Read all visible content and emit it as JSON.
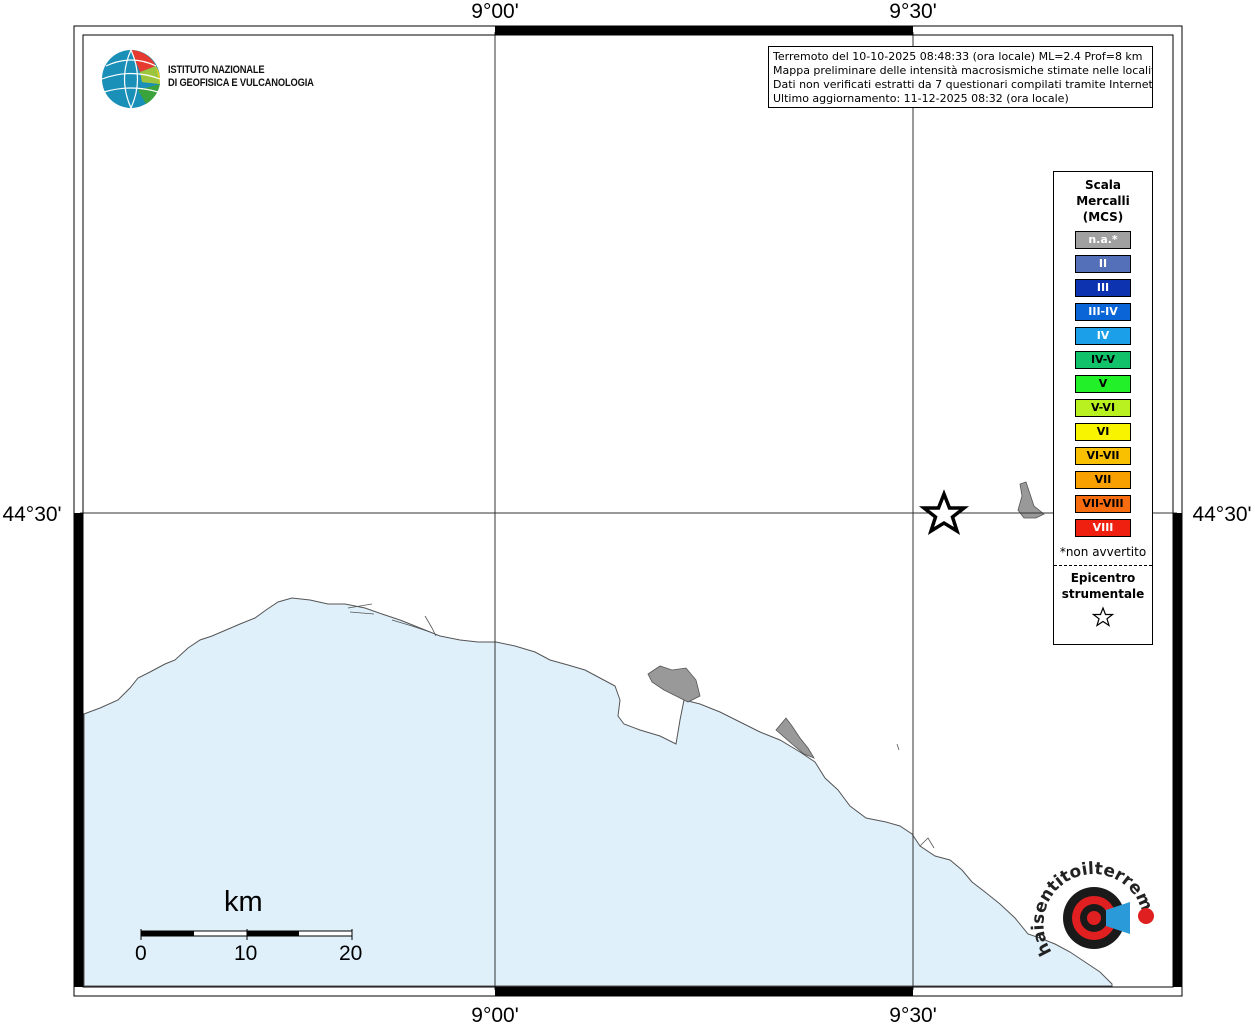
{
  "map": {
    "axes": {
      "top_labels": [
        "9°00'",
        "9°30'"
      ],
      "bottom_labels": [
        "9°00'",
        "9°30'"
      ],
      "left_label": "44°30'",
      "right_label": "44°30'"
    },
    "colors": {
      "sea": "#dff0fb",
      "coast": "#555555",
      "urban": "#999999",
      "frame": "#000000"
    }
  },
  "logo": {
    "line1": "ISTITUTO NAZIONALE",
    "line2": "DI GEOFISICA E VULCANOLOGIA",
    "icon": "ingv-globe-icon"
  },
  "info": {
    "line1": "Terremoto del 10-10-2025 08:48:33 (ora locale) ML=2.4 Prof=8 km",
    "line2": "Mappa preliminare delle intensità macrosismiche stimate nelle località",
    "line3": "Dati non verificati estratti da 7 questionari compilati tramite Internet.",
    "line4": "Ultimo aggiornamento: 11-12-2025 08:32 (ora locale)"
  },
  "legend": {
    "title_line1": "Scala",
    "title_line2": "Mercalli",
    "title_line3": "(MCS)",
    "items": [
      {
        "label": "n.a.*",
        "color": "#a0a0a0",
        "text_color": "#ffffff"
      },
      {
        "label": "II",
        "color": "#5470b8",
        "text_color": "#ffffff"
      },
      {
        "label": "III",
        "color": "#0d33b0",
        "text_color": "#ffffff"
      },
      {
        "label": "III-IV",
        "color": "#0a66d6",
        "text_color": "#ffffff"
      },
      {
        "label": "IV",
        "color": "#1a9fe8",
        "text_color": "#ffffff"
      },
      {
        "label": "IV-V",
        "color": "#12c26a",
        "text_color": "#000000"
      },
      {
        "label": "V",
        "color": "#22f028",
        "text_color": "#000000"
      },
      {
        "label": "V-VI",
        "color": "#b8f020",
        "text_color": "#000000"
      },
      {
        "label": "VI",
        "color": "#f8f400",
        "text_color": "#000000"
      },
      {
        "label": "VI-VII",
        "color": "#f8c000",
        "text_color": "#000000"
      },
      {
        "label": "VII",
        "color": "#f8a000",
        "text_color": "#000000"
      },
      {
        "label": "VII-VIII",
        "color": "#f86c10",
        "text_color": "#000000"
      },
      {
        "label": "VIII",
        "color": "#f02010",
        "text_color": "#ffffff"
      }
    ],
    "note": "*non avvertito",
    "epicenter_line1": "Epicentro",
    "epicenter_line2": "strumentale",
    "epicenter_icon": "star-outline-icon"
  },
  "scalebar": {
    "unit": "km",
    "ticks": [
      "0",
      "10",
      "20"
    ]
  },
  "epicenter": {
    "icon": "star-outline-icon"
  },
  "watermark": {
    "text": "haisentitoilterremoto.it",
    "icon": "haisentito-target-icon"
  }
}
